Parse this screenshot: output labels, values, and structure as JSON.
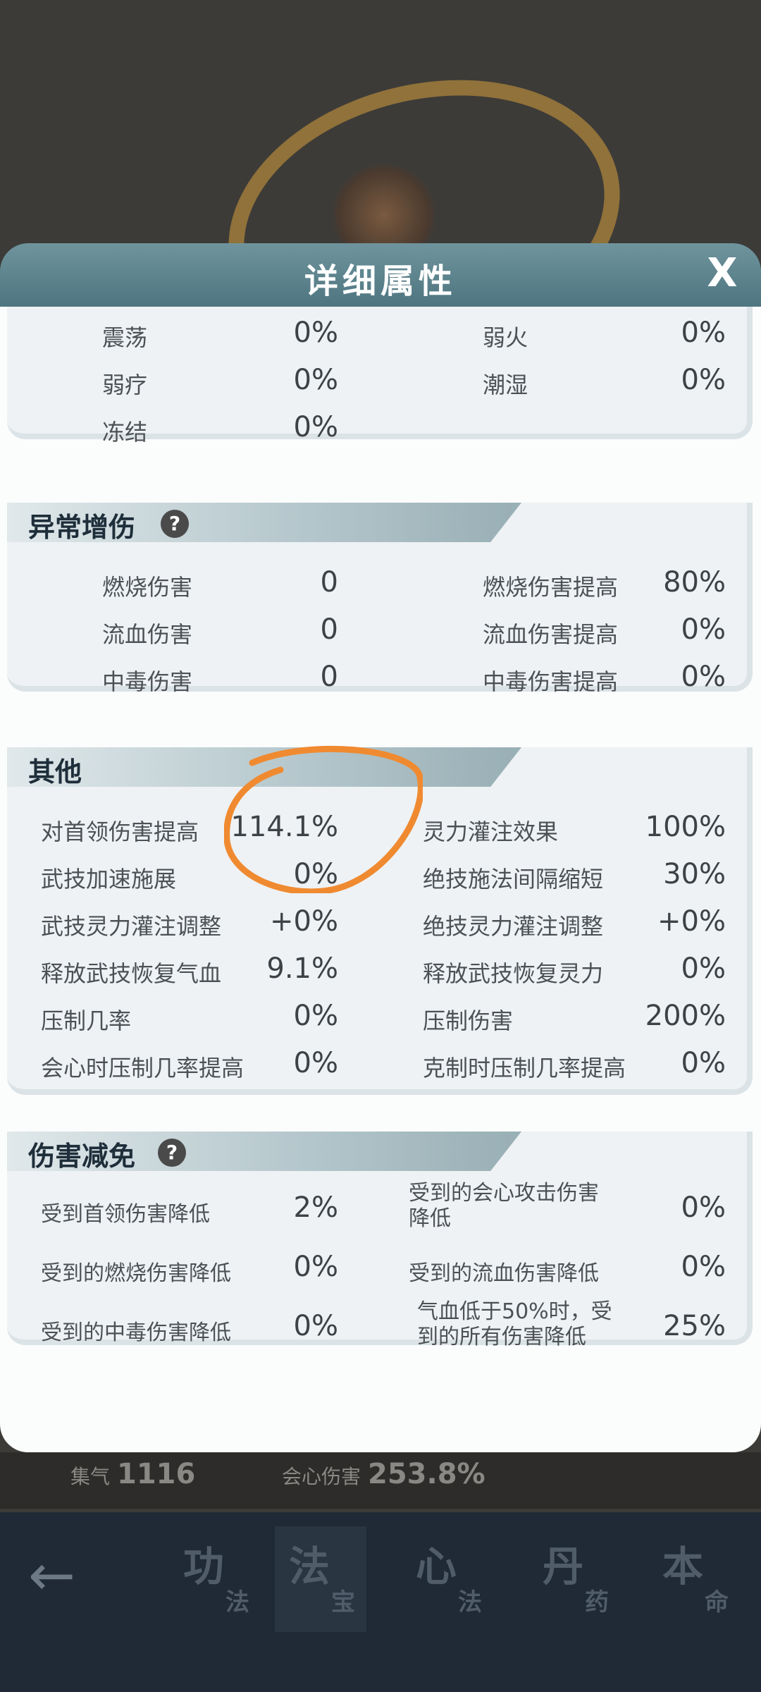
{
  "modal": {
    "title": "详细属性",
    "close_label": "X"
  },
  "partial_top": {
    "rows": [
      {
        "left_label": "震荡",
        "left_value": "0%",
        "right_label": "弱火",
        "right_value": "0%"
      },
      {
        "left_label": "弱疗",
        "left_value": "0%",
        "right_label": "潮湿",
        "right_value": "0%"
      },
      {
        "left_label": "冻结",
        "left_value": "0%"
      }
    ]
  },
  "abnormal": {
    "title": "异常增伤",
    "help": "?",
    "rows": [
      {
        "left_label": "燃烧伤害",
        "left_value": "0",
        "right_label": "燃烧伤害提高",
        "right_value": "80%"
      },
      {
        "left_label": "流血伤害",
        "left_value": "0",
        "right_label": "流血伤害提高",
        "right_value": "0%"
      },
      {
        "left_label": "中毒伤害",
        "left_value": "0",
        "right_label": "中毒伤害提高",
        "right_value": "0%"
      }
    ]
  },
  "other": {
    "title": "其他",
    "rows": [
      {
        "left_label": "对首领伤害提高",
        "left_value": "114.1%",
        "right_label": "灵力灌注效果",
        "right_value": "100%"
      },
      {
        "left_label": "武技加速施展",
        "left_value": "0%",
        "right_label": "绝技施法间隔缩短",
        "right_value": "30%"
      },
      {
        "left_label": "武技灵力灌注调整",
        "left_value": "+0%",
        "right_label": "绝技灵力灌注调整",
        "right_value": "+0%"
      },
      {
        "left_label": "释放武技恢复气血",
        "left_value": "9.1%",
        "right_label": "释放武技恢复灵力",
        "right_value": "0%"
      },
      {
        "left_label": "压制几率",
        "left_value": "0%",
        "right_label": "压制伤害",
        "right_value": "200%"
      },
      {
        "left_label": "会心时压制几率提高",
        "left_value": "0%",
        "right_label": "克制时压制几率提高",
        "right_value": "0%"
      }
    ]
  },
  "reduction": {
    "title": "伤害减免",
    "help": "?",
    "rows": [
      {
        "left_label": "受到首领伤害降低",
        "left_value": "2%",
        "right_label": "受到的会心攻击伤害降低",
        "right_value": "0%"
      },
      {
        "left_label": "受到的燃烧伤害降低",
        "left_value": "0%",
        "right_label": "受到的流血伤害降低",
        "right_value": "0%"
      },
      {
        "left_label": "受到的中毒伤害降低",
        "left_value": "0%",
        "right_label": "气血低于50%时，受到的所有伤害降低",
        "right_value": "25%"
      }
    ]
  },
  "background_stats": {
    "qi_label": "集气",
    "qi_value": "1116",
    "crit_label": "会心伤害",
    "crit_value": "253.8%"
  },
  "bottom_nav": {
    "back_icon": "back-arrow-icon",
    "tabs": [
      {
        "big": "功",
        "small": "法"
      },
      {
        "big": "法",
        "small": "宝"
      },
      {
        "big": "心",
        "small": "法"
      },
      {
        "big": "丹",
        "small": "药"
      },
      {
        "big": "本",
        "small": "命"
      }
    ]
  },
  "colors": {
    "header": "#5a808a",
    "scribble": "#f08a30",
    "panel": "#eef2f4"
  }
}
